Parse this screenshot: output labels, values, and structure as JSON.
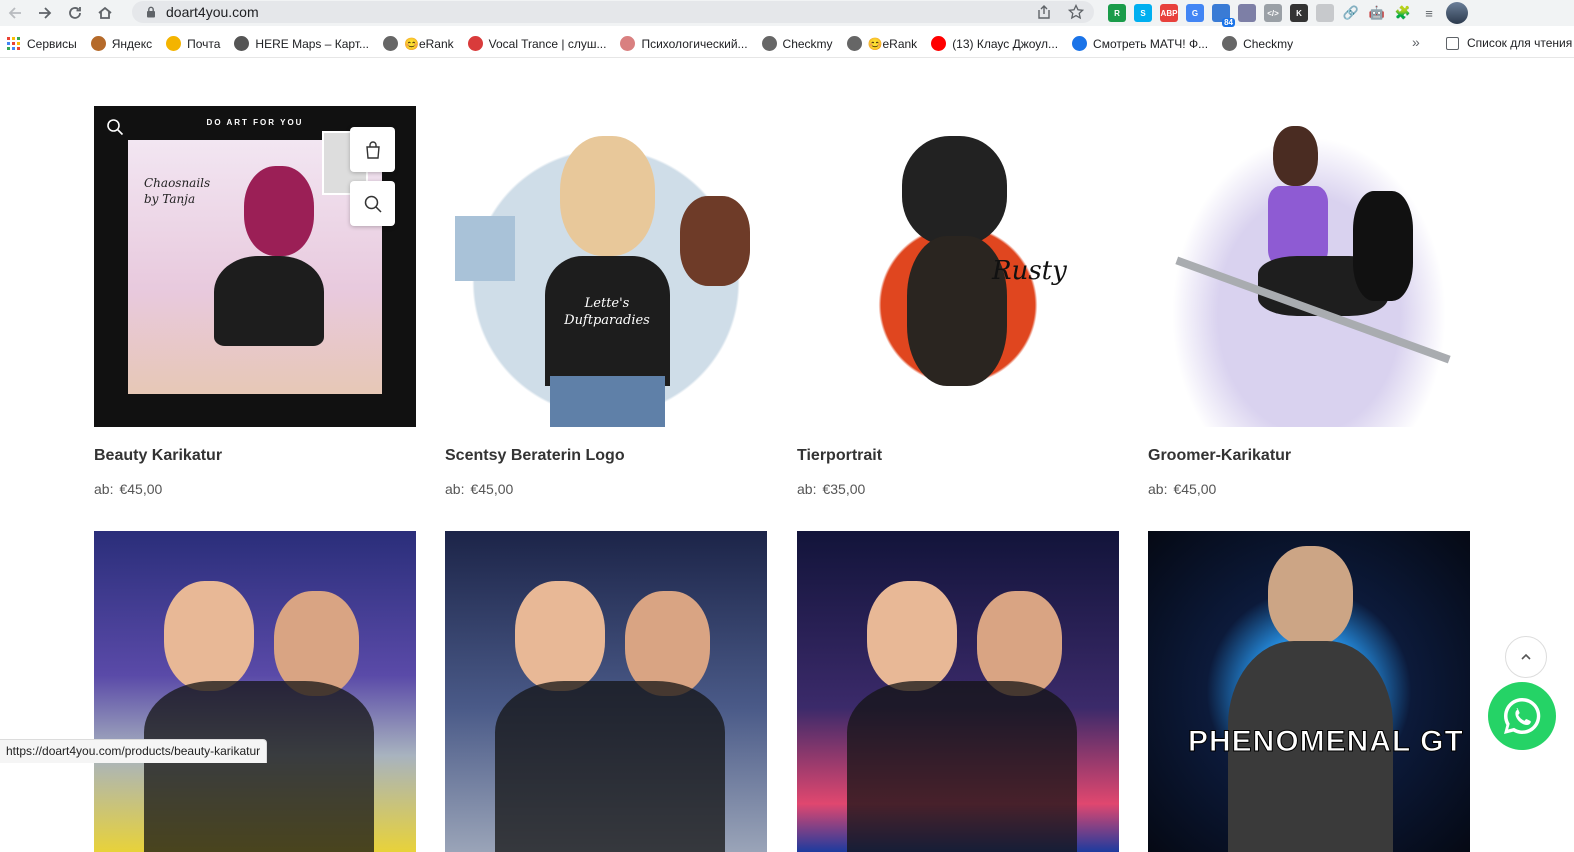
{
  "browser": {
    "url": "doart4you.com",
    "extensions": [
      {
        "name": "rss-icon",
        "color": "#1a9c4a",
        "text": "R"
      },
      {
        "name": "skype-icon",
        "color": "#00aff0",
        "text": "S"
      },
      {
        "name": "adblock-icon",
        "color": "#e8413c",
        "text": "ABP"
      },
      {
        "name": "translate-icon",
        "color": "#4285f4",
        "text": "G"
      },
      {
        "name": "counter-icon",
        "color": "#3a7bd5",
        "text": "",
        "badge": "84"
      },
      {
        "name": "circle-ext-icon",
        "color": "#7d7fa6",
        "text": ""
      },
      {
        "name": "code-ext-icon",
        "color": "#9aa0a6",
        "text": "</>"
      },
      {
        "name": "k-ext-icon",
        "color": "#333",
        "text": "K"
      },
      {
        "name": "moon-ext-icon",
        "color": "#c7c9cc",
        "text": ""
      }
    ]
  },
  "bookmarks": [
    {
      "label": "Сервисы",
      "icon": "apps-icon",
      "color": "#ea4335"
    },
    {
      "label": "Яндекс",
      "icon": "yandex-icon",
      "color": "#b56a2a"
    },
    {
      "label": "Почта",
      "icon": "mail-icon",
      "color": "#f4b400"
    },
    {
      "label": "HERE Maps – Карт...",
      "icon": "here-maps-icon",
      "color": "#555"
    },
    {
      "label": "😊eRank",
      "icon": "globe-icon",
      "color": "#666"
    },
    {
      "label": "Vocal Trance | слуш...",
      "icon": "vt-icon",
      "color": "#d93b3b"
    },
    {
      "label": "Психологический...",
      "icon": "psy-icon",
      "color": "#d98080"
    },
    {
      "label": "Checkmy",
      "icon": "globe-icon",
      "color": "#666"
    },
    {
      "label": "😊eRank",
      "icon": "globe-icon",
      "color": "#666"
    },
    {
      "label": "(13) Клаус Джоул...",
      "icon": "youtube-icon",
      "color": "#ff0000"
    },
    {
      "label": "Смотреть МАТЧ! Ф...",
      "icon": "s-icon",
      "color": "#1a73e8"
    },
    {
      "label": "Checkmy",
      "icon": "globe-icon",
      "color": "#666"
    }
  ],
  "bookmarks_more": "»",
  "reading_list": "Список для чтения",
  "products": [
    {
      "name": "Beauty Karikatur",
      "price_prefix": "ab:",
      "price": "€45,00",
      "logo_text": "DO ART FOR YOU",
      "art_text": "Chaosnails by Tanja"
    },
    {
      "name": "Scentsy Beraterin Logo",
      "price_prefix": "ab:",
      "price": "€45,00",
      "art_text": "Lette's Duftparadies"
    },
    {
      "name": "Tierportrait",
      "price_prefix": "ab:",
      "price": "€35,00",
      "art_text": "Rusty"
    },
    {
      "name": "Groomer-Karikatur",
      "price_prefix": "ab:",
      "price": "€45,00"
    },
    {
      "name": "",
      "price_prefix": "",
      "price": ""
    },
    {
      "name": "",
      "price_prefix": "",
      "price": ""
    },
    {
      "name": "",
      "price_prefix": "",
      "price": ""
    },
    {
      "name": "",
      "price_prefix": "",
      "price": "",
      "art_text": "PHENOMENAL GT"
    }
  ],
  "status_url": "https://doart4you.com/products/beauty-karikatur",
  "colors": {
    "whatsapp": "#25d366",
    "text": "#333333"
  }
}
